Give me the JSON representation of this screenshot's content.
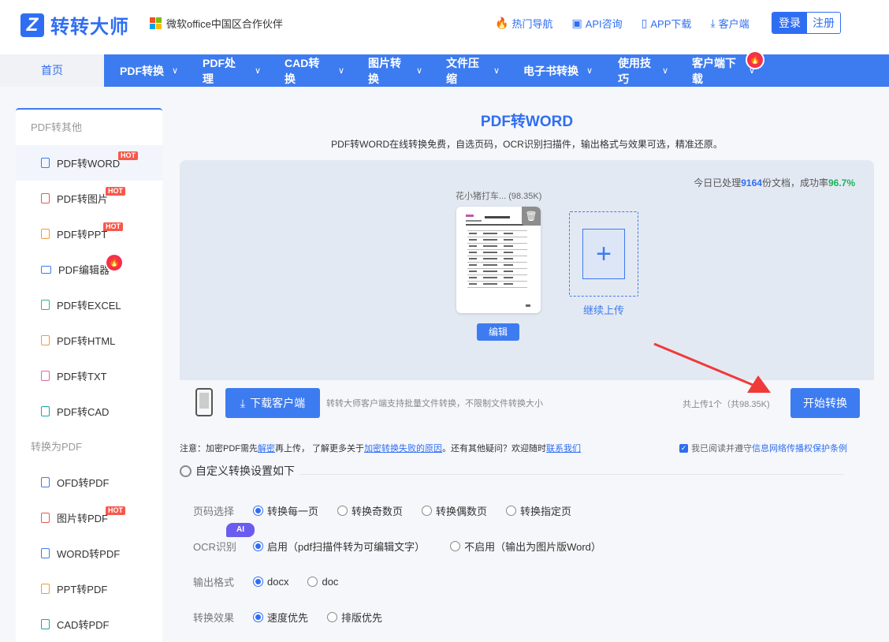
{
  "header": {
    "logo_glyph": "Z",
    "logo_text": "转转大师",
    "partner": "微软office中国区合作伙伴",
    "links": [
      {
        "icon": "fire-icon",
        "label": "热门导航"
      },
      {
        "icon": "chat-icon",
        "label": "API咨询"
      },
      {
        "icon": "phone-icon",
        "label": "APP下载"
      },
      {
        "icon": "download-icon",
        "label": "客户端"
      }
    ],
    "login": "登录",
    "register": "注册"
  },
  "nav": {
    "home": "首页",
    "items": [
      "PDF转换",
      "PDF处理",
      "CAD转换",
      "图片转换",
      "文件压缩",
      "电子书转换",
      "使用技巧",
      "客户端下载"
    ]
  },
  "sidebar": {
    "group1": "PDF转其他",
    "group1_items": [
      {
        "label": "PDF转WORD",
        "badge": "HOT"
      },
      {
        "label": "PDF转图片",
        "badge": "HOT"
      },
      {
        "label": "PDF转PPT",
        "badge": "HOT"
      },
      {
        "label": "PDF编辑器",
        "badge": "fire"
      },
      {
        "label": "PDF转EXCEL",
        "badge": ""
      },
      {
        "label": "PDF转HTML",
        "badge": ""
      },
      {
        "label": "PDF转TXT",
        "badge": ""
      },
      {
        "label": "PDF转CAD",
        "badge": ""
      }
    ],
    "group2": "转换为PDF",
    "group2_items": [
      {
        "label": "OFD转PDF",
        "badge": ""
      },
      {
        "label": "图片转PDF",
        "badge": "HOT"
      },
      {
        "label": "WORD转PDF",
        "badge": ""
      },
      {
        "label": "PPT转PDF",
        "badge": ""
      },
      {
        "label": "CAD转PDF",
        "badge": ""
      }
    ]
  },
  "main": {
    "title": "PDF转WORD",
    "subtitle": "PDF转WORD在线转换免费，自选页码，OCR识别扫描件，输出格式与效果可选，精准还原。",
    "stats_prefix": "今日已处理",
    "stats_count": "9164",
    "stats_mid": "份文档，成功率",
    "stats_rate": "96.7%",
    "file_name": "花小猪打车... (98.35K)",
    "edit_label": "编辑",
    "continue_label": "继续上传",
    "download_client": "下载客户端",
    "download_note": "转转大师客户端支持批量文件转换，不限制文件转换大小",
    "total": "共上传1个（共98.35K)",
    "start": "开始转换",
    "notice_1": "注意：加密PDF需先",
    "notice_link1": "解密",
    "notice_2": "再上传， 了解更多关于",
    "notice_link2": "加密转换失败的原因",
    "notice_3": "。还有其他疑问？欢迎随时",
    "notice_link3": "联系我们",
    "agree_1": "我已阅读并遵守",
    "agree_link": "信息网络传播权保护条例",
    "settings_title": "自定义转换设置如下",
    "ai_badge": "AI",
    "options": {
      "pages": {
        "label": "页码选择",
        "choices": [
          "转换每一页",
          "转换奇数页",
          "转换偶数页",
          "转换指定页"
        ],
        "selected": 0
      },
      "ocr": {
        "label": "OCR识别",
        "choices": [
          "启用（pdf扫描件转为可编辑文字）",
          "不启用（输出为图片版Word）"
        ],
        "selected": 0
      },
      "format": {
        "label": "输出格式",
        "choices": [
          "docx",
          "doc"
        ],
        "selected": 0
      },
      "effect": {
        "label": "转换效果",
        "choices": [
          "速度优先",
          "排版优先"
        ],
        "selected": 0
      }
    }
  },
  "colors": {
    "brand": "#3d7bf0",
    "hot": "#f7584a",
    "success": "#19b35a"
  }
}
